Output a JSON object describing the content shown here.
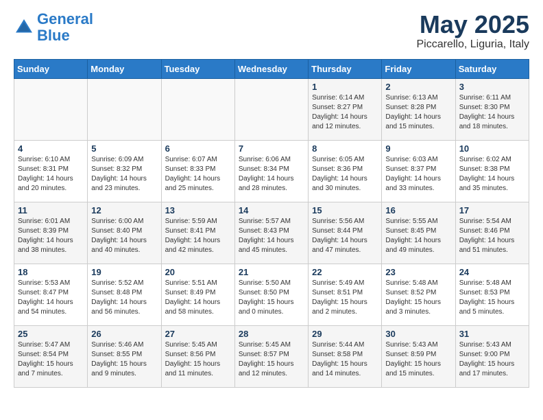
{
  "logo": {
    "line1": "General",
    "line2": "Blue"
  },
  "title": "May 2025",
  "location": "Piccarello, Liguria, Italy",
  "days_of_week": [
    "Sunday",
    "Monday",
    "Tuesday",
    "Wednesday",
    "Thursday",
    "Friday",
    "Saturday"
  ],
  "weeks": [
    [
      {
        "day": "",
        "info": ""
      },
      {
        "day": "",
        "info": ""
      },
      {
        "day": "",
        "info": ""
      },
      {
        "day": "",
        "info": ""
      },
      {
        "day": "1",
        "info": "Sunrise: 6:14 AM\nSunset: 8:27 PM\nDaylight: 14 hours\nand 12 minutes."
      },
      {
        "day": "2",
        "info": "Sunrise: 6:13 AM\nSunset: 8:28 PM\nDaylight: 14 hours\nand 15 minutes."
      },
      {
        "day": "3",
        "info": "Sunrise: 6:11 AM\nSunset: 8:30 PM\nDaylight: 14 hours\nand 18 minutes."
      }
    ],
    [
      {
        "day": "4",
        "info": "Sunrise: 6:10 AM\nSunset: 8:31 PM\nDaylight: 14 hours\nand 20 minutes."
      },
      {
        "day": "5",
        "info": "Sunrise: 6:09 AM\nSunset: 8:32 PM\nDaylight: 14 hours\nand 23 minutes."
      },
      {
        "day": "6",
        "info": "Sunrise: 6:07 AM\nSunset: 8:33 PM\nDaylight: 14 hours\nand 25 minutes."
      },
      {
        "day": "7",
        "info": "Sunrise: 6:06 AM\nSunset: 8:34 PM\nDaylight: 14 hours\nand 28 minutes."
      },
      {
        "day": "8",
        "info": "Sunrise: 6:05 AM\nSunset: 8:36 PM\nDaylight: 14 hours\nand 30 minutes."
      },
      {
        "day": "9",
        "info": "Sunrise: 6:03 AM\nSunset: 8:37 PM\nDaylight: 14 hours\nand 33 minutes."
      },
      {
        "day": "10",
        "info": "Sunrise: 6:02 AM\nSunset: 8:38 PM\nDaylight: 14 hours\nand 35 minutes."
      }
    ],
    [
      {
        "day": "11",
        "info": "Sunrise: 6:01 AM\nSunset: 8:39 PM\nDaylight: 14 hours\nand 38 minutes."
      },
      {
        "day": "12",
        "info": "Sunrise: 6:00 AM\nSunset: 8:40 PM\nDaylight: 14 hours\nand 40 minutes."
      },
      {
        "day": "13",
        "info": "Sunrise: 5:59 AM\nSunset: 8:41 PM\nDaylight: 14 hours\nand 42 minutes."
      },
      {
        "day": "14",
        "info": "Sunrise: 5:57 AM\nSunset: 8:43 PM\nDaylight: 14 hours\nand 45 minutes."
      },
      {
        "day": "15",
        "info": "Sunrise: 5:56 AM\nSunset: 8:44 PM\nDaylight: 14 hours\nand 47 minutes."
      },
      {
        "day": "16",
        "info": "Sunrise: 5:55 AM\nSunset: 8:45 PM\nDaylight: 14 hours\nand 49 minutes."
      },
      {
        "day": "17",
        "info": "Sunrise: 5:54 AM\nSunset: 8:46 PM\nDaylight: 14 hours\nand 51 minutes."
      }
    ],
    [
      {
        "day": "18",
        "info": "Sunrise: 5:53 AM\nSunset: 8:47 PM\nDaylight: 14 hours\nand 54 minutes."
      },
      {
        "day": "19",
        "info": "Sunrise: 5:52 AM\nSunset: 8:48 PM\nDaylight: 14 hours\nand 56 minutes."
      },
      {
        "day": "20",
        "info": "Sunrise: 5:51 AM\nSunset: 8:49 PM\nDaylight: 14 hours\nand 58 minutes."
      },
      {
        "day": "21",
        "info": "Sunrise: 5:50 AM\nSunset: 8:50 PM\nDaylight: 15 hours\nand 0 minutes."
      },
      {
        "day": "22",
        "info": "Sunrise: 5:49 AM\nSunset: 8:51 PM\nDaylight: 15 hours\nand 2 minutes."
      },
      {
        "day": "23",
        "info": "Sunrise: 5:48 AM\nSunset: 8:52 PM\nDaylight: 15 hours\nand 3 minutes."
      },
      {
        "day": "24",
        "info": "Sunrise: 5:48 AM\nSunset: 8:53 PM\nDaylight: 15 hours\nand 5 minutes."
      }
    ],
    [
      {
        "day": "25",
        "info": "Sunrise: 5:47 AM\nSunset: 8:54 PM\nDaylight: 15 hours\nand 7 minutes."
      },
      {
        "day": "26",
        "info": "Sunrise: 5:46 AM\nSunset: 8:55 PM\nDaylight: 15 hours\nand 9 minutes."
      },
      {
        "day": "27",
        "info": "Sunrise: 5:45 AM\nSunset: 8:56 PM\nDaylight: 15 hours\nand 11 minutes."
      },
      {
        "day": "28",
        "info": "Sunrise: 5:45 AM\nSunset: 8:57 PM\nDaylight: 15 hours\nand 12 minutes."
      },
      {
        "day": "29",
        "info": "Sunrise: 5:44 AM\nSunset: 8:58 PM\nDaylight: 15 hours\nand 14 minutes."
      },
      {
        "day": "30",
        "info": "Sunrise: 5:43 AM\nSunset: 8:59 PM\nDaylight: 15 hours\nand 15 minutes."
      },
      {
        "day": "31",
        "info": "Sunrise: 5:43 AM\nSunset: 9:00 PM\nDaylight: 15 hours\nand 17 minutes."
      }
    ]
  ]
}
